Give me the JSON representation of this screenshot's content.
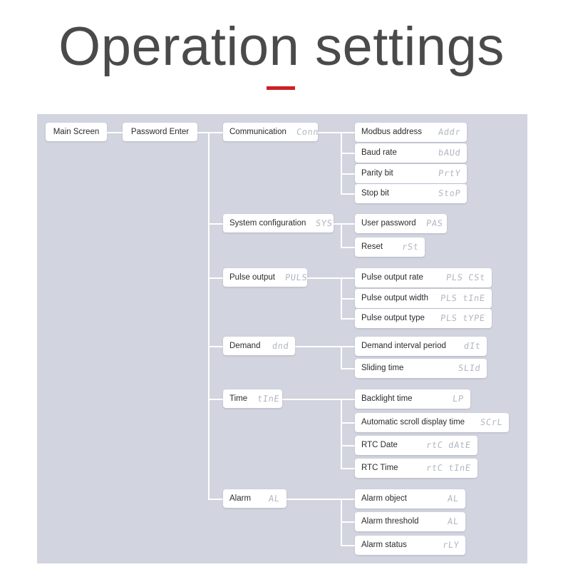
{
  "page": {
    "title": "Operation settings",
    "accent_color": "#cc2026",
    "panel_color": "#d2d4df",
    "node_color": "#ffffff",
    "code_color": "#b3b6c2",
    "line_color": "#ffffff"
  },
  "diagram": {
    "type": "tree",
    "root": {
      "label": "Main Screen",
      "code": ""
    },
    "gate": {
      "label": "Password Enter",
      "code": ""
    },
    "groups": [
      {
        "label": "Communication",
        "code": "Conn",
        "items": [
          {
            "label": "Modbus address",
            "code": "Addr"
          },
          {
            "label": "Baud rate",
            "code": "bAUd"
          },
          {
            "label": "Parity bit",
            "code": "PrtY"
          },
          {
            "label": "Stop bit",
            "code": "StoP"
          }
        ]
      },
      {
        "label": "System configuration",
        "code": "SYS",
        "items": [
          {
            "label": "User password",
            "code": "PAS"
          },
          {
            "label": "Reset",
            "code": "rSt"
          }
        ]
      },
      {
        "label": "Pulse output",
        "code": "PULS",
        "items": [
          {
            "label": "Pulse output rate",
            "code": "PLS CSt"
          },
          {
            "label": "Pulse output width",
            "code": "PLS tInE"
          },
          {
            "label": "Pulse output type",
            "code": "PLS tYPE"
          }
        ]
      },
      {
        "label": "Demand",
        "code": "dnd",
        "items": [
          {
            "label": "Demand interval period",
            "code": "dIt"
          },
          {
            "label": "Sliding time",
            "code": "SLId"
          }
        ]
      },
      {
        "label": "Time",
        "code": "tInE",
        "items": [
          {
            "label": "Backlight time",
            "code": "LP"
          },
          {
            "label": "Automatic scroll display time",
            "code": "SCrL"
          },
          {
            "label": "RTC Date",
            "code": "rtC dAtE"
          },
          {
            "label": "RTC Time",
            "code": "rtC tInE"
          }
        ]
      },
      {
        "label": "Alarm",
        "code": "AL",
        "items": [
          {
            "label": "Alarm object",
            "code": "AL"
          },
          {
            "label": "Alarm threshold",
            "code": "AL"
          },
          {
            "label": "Alarm status",
            "code": "rLY"
          }
        ]
      }
    ]
  }
}
